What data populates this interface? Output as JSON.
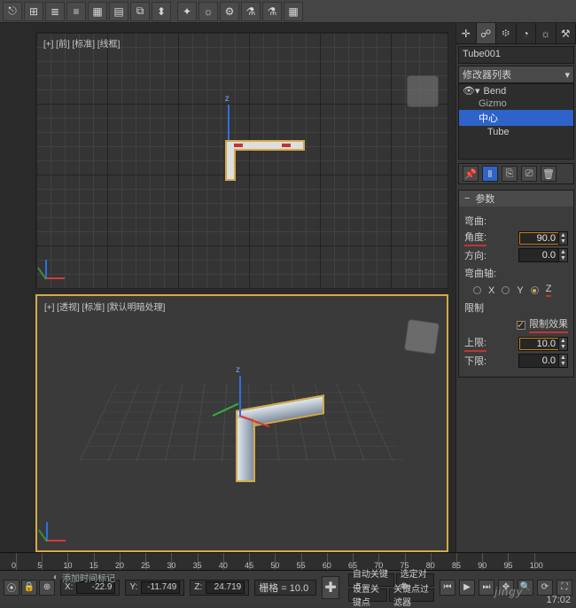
{
  "toolbar": {
    "icons": [
      "⎋",
      "⊞",
      "≣",
      "≡",
      "▦",
      "▤",
      "⧉",
      "⬍",
      "✦",
      "☼",
      "⚙",
      "⚗",
      "⚗",
      "▦"
    ]
  },
  "viewports": {
    "top_label": "[+] [前] [标准] [线框]",
    "bottom_label": "[+] [透视] [标准] [默认明暗处理]",
    "z_axis": "z"
  },
  "panel": {
    "tabs": [
      "✛",
      "☍",
      "፨",
      "◔",
      "☼",
      "⚒"
    ],
    "object_name": "Tube001",
    "modlist_header": "修改器列表",
    "mod_stack": {
      "bend": "Bend",
      "gizmo": "Gizmo",
      "center": "中心",
      "tube": "Tube"
    },
    "stack_icons": [
      "📌",
      "Ⅱ",
      "⎘",
      "⎚",
      "🗑"
    ],
    "rollout_title": "参数",
    "group_bend": "弯曲:",
    "angle_label": "角度:",
    "angle_value": "90.0",
    "direction_label": "方向:",
    "direction_value": "0.0",
    "group_axis": "弯曲轴:",
    "axis_x": "X",
    "axis_y": "Y",
    "axis_z": "Z",
    "group_limit": "限制",
    "limit_effect": "限制效果",
    "upper_label": "上限:",
    "upper_value": "10.0",
    "lower_label": "下限:",
    "lower_value": "0.0"
  },
  "timeline": {
    "ticks": [
      "0",
      "5",
      "10",
      "15",
      "20",
      "25",
      "30",
      "35",
      "40",
      "45",
      "50",
      "55",
      "60",
      "65",
      "70",
      "75",
      "80",
      "85",
      "90",
      "95",
      "100"
    ]
  },
  "status": {
    "x_label": "X:",
    "x_value": "-22.9",
    "y_label": "Y:",
    "y_value": "-11.749",
    "z_label": "Z:",
    "z_value": "24.719",
    "grid_label": "栅格 = 10.0",
    "add_time_tag": "添加时间标记",
    "auto_key": "自动关键点",
    "sel_obj": "选定对象",
    "set_key": "设置关键点",
    "key_filter": "关键点过滤器",
    "watermark": "jingy",
    "clock": "17:02"
  }
}
